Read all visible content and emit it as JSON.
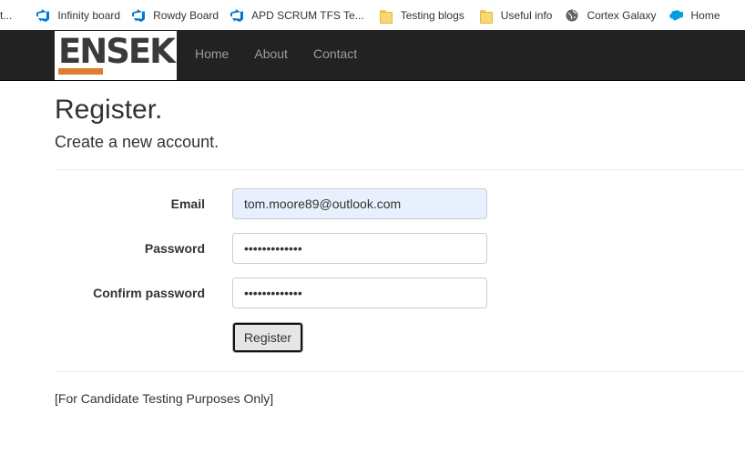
{
  "bookmarks": [
    {
      "label": "t...",
      "icon": "truncated-icon"
    },
    {
      "label": "Infinity board",
      "icon": "azure-devops-icon"
    },
    {
      "label": "Rowdy Board",
      "icon": "azure-devops-icon"
    },
    {
      "label": "APD SCRUM TFS Te...",
      "icon": "azure-devops-icon"
    },
    {
      "label": "Testing blogs",
      "icon": "folder-icon"
    },
    {
      "label": "Useful info",
      "icon": "folder-icon"
    },
    {
      "label": "Cortex Galaxy",
      "icon": "globe-icon"
    },
    {
      "label": "Home",
      "icon": "salesforce-cloud-icon"
    },
    {
      "label": "",
      "icon": "excel-icon"
    }
  ],
  "navbar": {
    "brand": "ENSEK",
    "brand_accent_color": "#e07b2f",
    "links": [
      "Home",
      "About",
      "Contact"
    ]
  },
  "page": {
    "title": "Register.",
    "subtitle": "Create a new account."
  },
  "form": {
    "email_label": "Email",
    "email_value": "tom.moore89@outlook.com",
    "password_label": "Password",
    "password_value": "•••••••••••••",
    "confirm_label": "Confirm password",
    "confirm_value": "•••••••••••••",
    "submit_label": "Register"
  },
  "footer": {
    "text": "[For Candidate Testing Purposes Only]"
  }
}
